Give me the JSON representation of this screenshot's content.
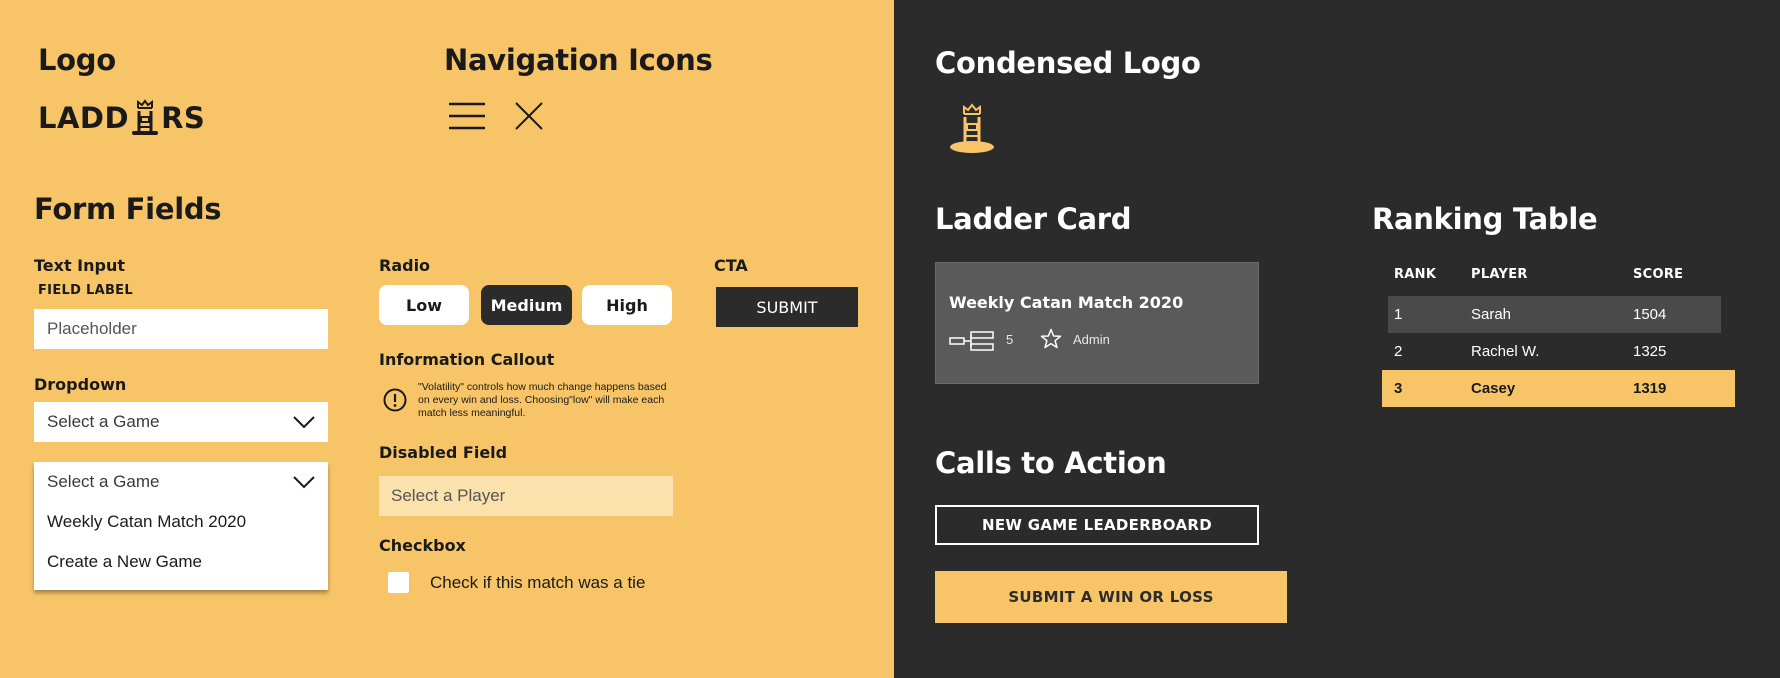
{
  "left": {
    "logo_heading": "Logo",
    "logo_text_before": "LADD",
    "logo_text_after": "RS",
    "nav_heading": "Navigation Icons",
    "form_heading": "Form Fields",
    "text_input": {
      "title": "Text Input",
      "field_label": "FIELD LABEL",
      "placeholder": "Placeholder"
    },
    "dropdown": {
      "title": "Dropdown",
      "value": "Select a Game",
      "open_value": "Select a Game",
      "options": [
        "Weekly Catan Match 2020",
        "Create a New Game"
      ]
    },
    "radio": {
      "title": "Radio",
      "options": [
        "Low",
        "Medium",
        "High"
      ],
      "selected": "Medium"
    },
    "cta": {
      "title": "CTA",
      "submit_label": "SUBMIT"
    },
    "callout": {
      "title": "Information Callout",
      "text": "\"Volatility\" controls how much change happens based on every win and loss. Choosing\"low\" will make each match less meaningful."
    },
    "disabled": {
      "title": "Disabled Field",
      "value": "Select a Player"
    },
    "checkbox": {
      "title": "Checkbox",
      "label": "Check if this match was a tie",
      "checked": false
    }
  },
  "right": {
    "condensed_logo_heading": "Condensed Logo",
    "ladder_card_heading": "Ladder Card",
    "card": {
      "title": "Weekly Catan Match 2020",
      "count": "5",
      "role": "Admin"
    },
    "cta_heading": "Calls to Action",
    "cta_outline_label": "NEW GAME LEADERBOARD",
    "cta_filled_label": "SUBMIT A WIN OR LOSS",
    "ranking_heading": "Ranking Table",
    "table": {
      "headers": [
        "RANK",
        "PLAYER",
        "SCORE"
      ],
      "rows": [
        {
          "rank": "1",
          "player": "Sarah",
          "score": "1504"
        },
        {
          "rank": "2",
          "player": "Rachel W.",
          "score": "1325"
        },
        {
          "rank": "3",
          "player": "Casey",
          "score": "1319"
        }
      ]
    }
  },
  "colors": {
    "yellow": "#f7c568",
    "dark": "#2b2b2b",
    "card_gray": "#5a5a5a",
    "row_gray": "#4a4a4a",
    "disabled_yellow": "#fbe1ab"
  },
  "icons": [
    "hamburger-menu-icon",
    "close-icon",
    "ladder-crown-icon",
    "chevron-down-icon",
    "info-icon",
    "bracket-icon",
    "star-icon"
  ]
}
